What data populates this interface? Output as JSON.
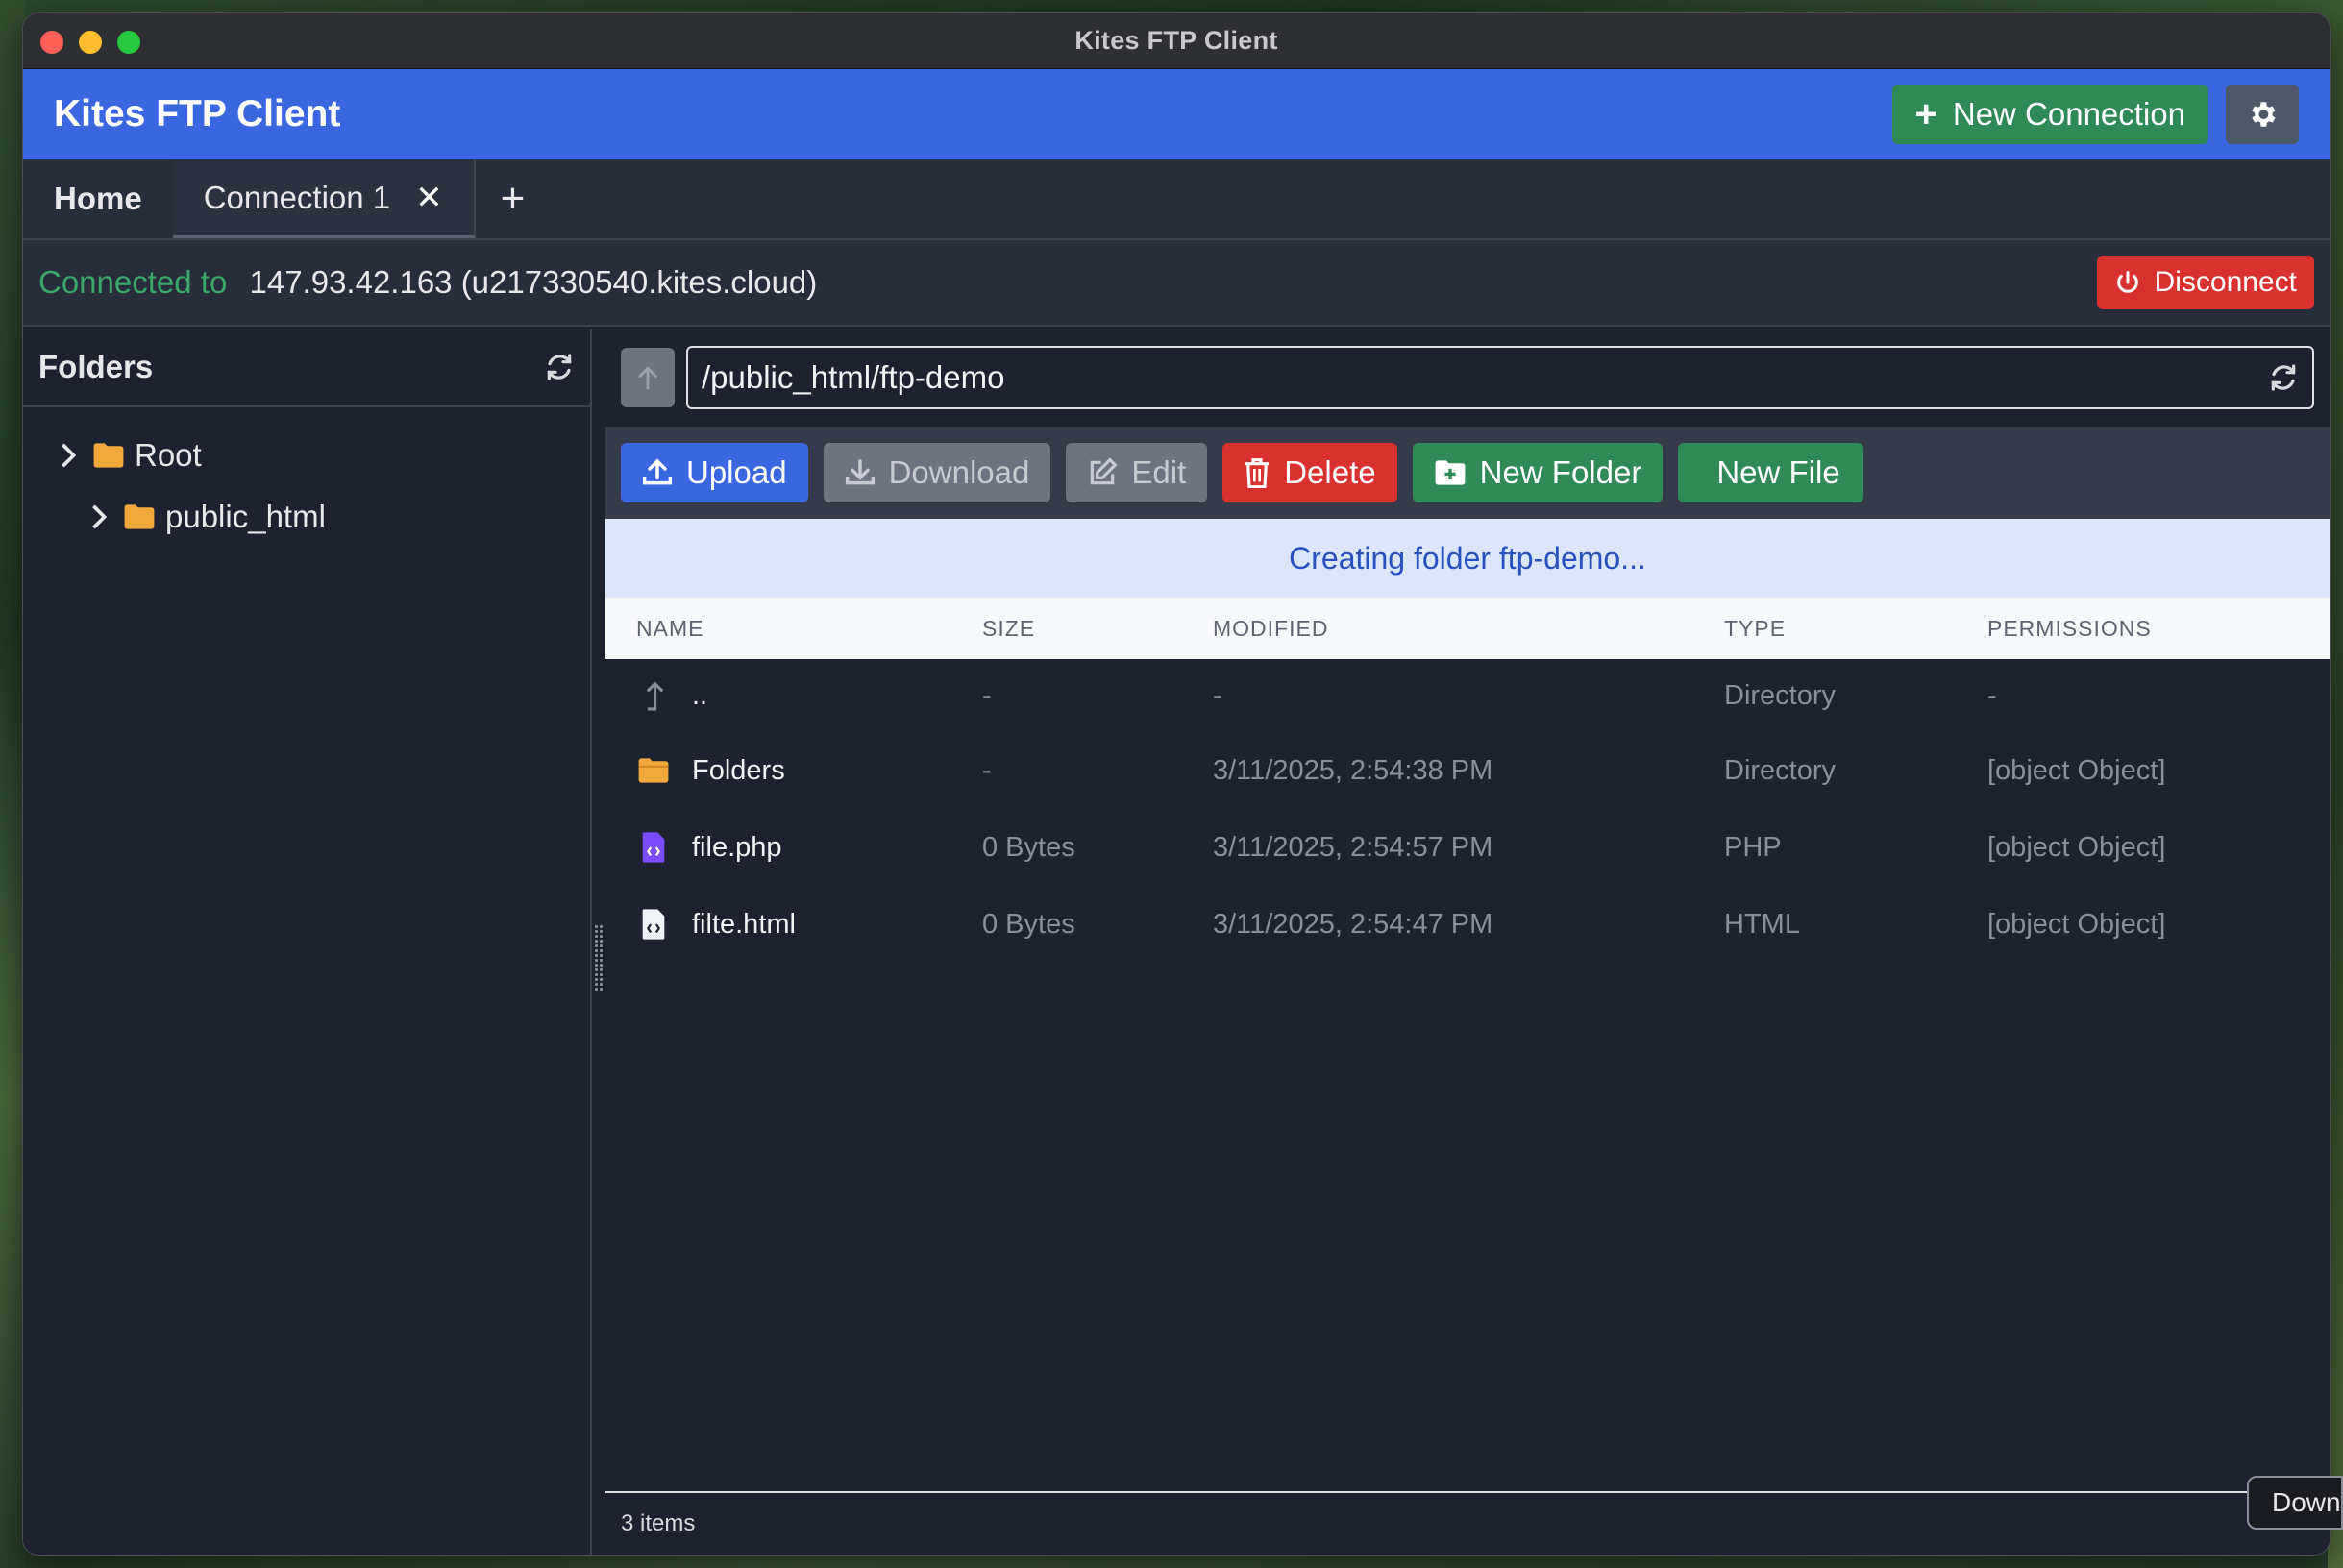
{
  "window": {
    "title": "Kites FTP Client"
  },
  "header": {
    "brand": "Kites FTP Client",
    "new_connection_label": "New Connection",
    "settings_icon": "gear-icon"
  },
  "tabs": {
    "home": "Home",
    "items": [
      {
        "label": "Connection 1",
        "close": "✕"
      }
    ],
    "add": "+"
  },
  "status": {
    "label": "Connected to",
    "host": "147.93.42.163 (u217330540.kites.cloud)",
    "disconnect_label": "Disconnect"
  },
  "sidebar": {
    "title": "Folders",
    "tree": [
      {
        "label": "Root"
      },
      {
        "label": "public_html"
      }
    ]
  },
  "path": {
    "value": "/public_html/ftp-demo"
  },
  "toolbar": {
    "upload": "Upload",
    "download": "Download",
    "edit": "Edit",
    "delete": "Delete",
    "new_folder": "New Folder",
    "new_file": "New File"
  },
  "banner": {
    "message": "Creating folder ftp-demo..."
  },
  "table": {
    "headers": [
      "NAME",
      "SIZE",
      "MODIFIED",
      "TYPE",
      "PERMISSIONS"
    ],
    "rows": [
      {
        "name": "..",
        "size": "-",
        "modified": "-",
        "type": "Directory",
        "permissions": "-",
        "icon": "parent-dir-icon"
      },
      {
        "name": "Folders",
        "size": "-",
        "modified": "3/11/2025, 2:54:38 PM",
        "type": "Directory",
        "permissions": "[object Object]",
        "icon": "folder-icon"
      },
      {
        "name": "file.php",
        "size": "0 Bytes",
        "modified": "3/11/2025, 2:54:57 PM",
        "type": "PHP",
        "permissions": "[object Object]",
        "icon": "php-file-icon"
      },
      {
        "name": "filte.html",
        "size": "0 Bytes",
        "modified": "3/11/2025, 2:54:47 PM",
        "type": "HTML",
        "permissions": "[object Object]",
        "icon": "html-file-icon"
      }
    ]
  },
  "footer": {
    "count": "3 items"
  },
  "tooltip": {
    "text": "Downlo"
  },
  "colors": {
    "accent": "#3a66e0",
    "success": "#2f8a56",
    "danger": "#d93030",
    "folder": "#f2a93b",
    "php": "#7c4dff"
  }
}
